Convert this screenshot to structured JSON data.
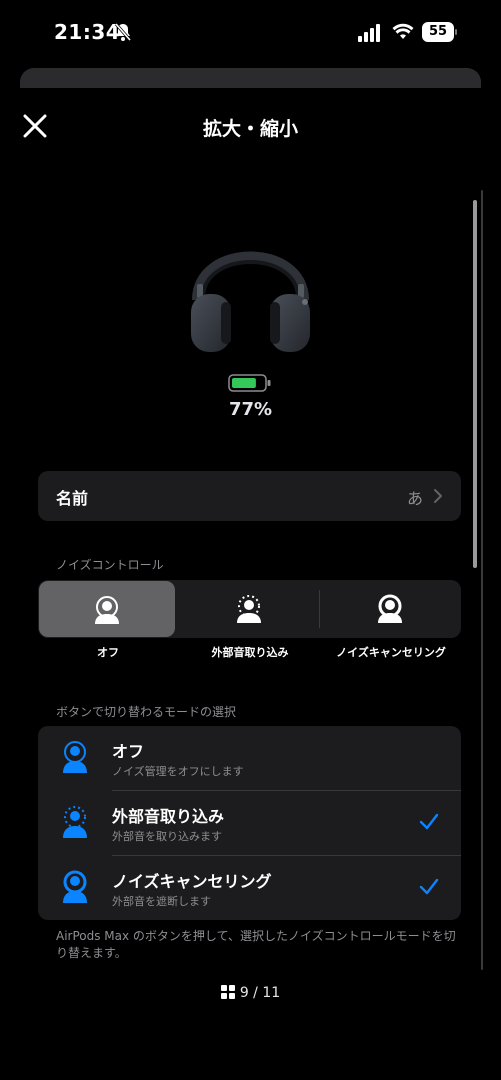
{
  "status_bar": {
    "time": "21:34",
    "battery_level": "55",
    "icons": [
      "bell-slash-icon",
      "cellular-signal-icon",
      "wifi-icon",
      "battery-icon"
    ]
  },
  "header": {
    "title": "拡大・縮小",
    "close_icon": "close-icon"
  },
  "device": {
    "battery_percent": "77%",
    "battery_fill": 0.77,
    "battery_color": "#34c759"
  },
  "name_row": {
    "label": "名前",
    "value": "あ"
  },
  "noise_control": {
    "section_label": "ノイズコントロール",
    "options": [
      {
        "label": "オフ",
        "selected": true
      },
      {
        "label": "外部音取り込み",
        "selected": false
      },
      {
        "label": "ノイズキャンセリング",
        "selected": false
      }
    ]
  },
  "mode_select": {
    "section_label": "ボタンで切り替わるモードの選択",
    "items": [
      {
        "title": "オフ",
        "description": "ノイズ管理をオフにします",
        "checked": false
      },
      {
        "title": "外部音取り込み",
        "description": "外部音を取り込みます",
        "checked": true
      },
      {
        "title": "ノイズキャンセリング",
        "description": "外部音を遮断します",
        "checked": true
      }
    ],
    "footer": "AirPods Max のボタンを押して、選択したノイズコントロールモードを切り替えます。"
  },
  "pagination": {
    "label": "9 / 11"
  },
  "colors": {
    "accent": "#0a84ff",
    "background": "#000000",
    "card": "#1c1c1e"
  }
}
